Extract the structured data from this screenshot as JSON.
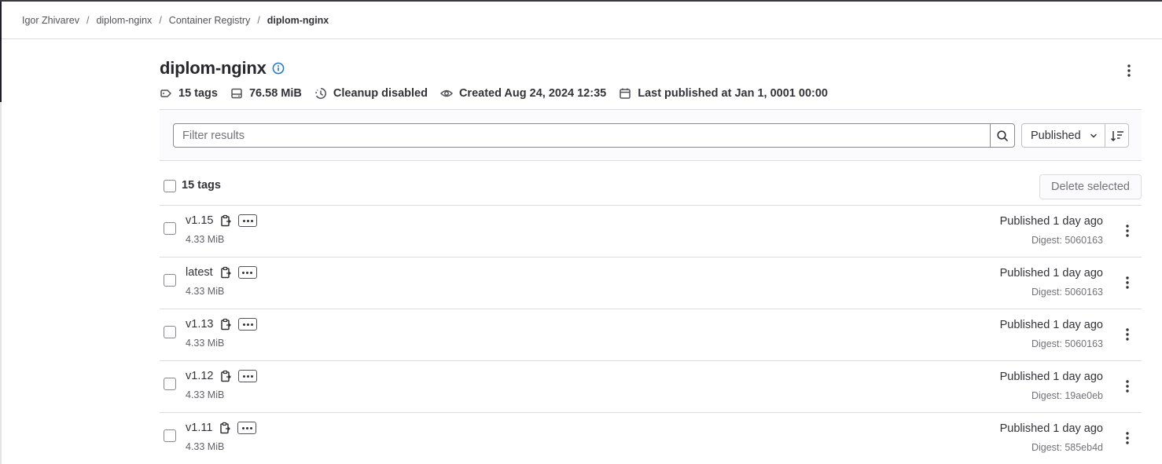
{
  "breadcrumb": {
    "items": [
      "Igor Zhivarev",
      "diplom-nginx",
      "Container Registry"
    ],
    "current": "diplom-nginx",
    "separator": "/"
  },
  "header": {
    "title": "diplom-nginx",
    "meta": {
      "tags": "15 tags",
      "size": "76.58 MiB",
      "cleanup": "Cleanup disabled",
      "created": "Created Aug 24, 2024 12:35",
      "last_published": "Last published at Jan 1, 0001 00:00"
    }
  },
  "filter": {
    "placeholder": "Filter results",
    "sort_label": "Published"
  },
  "list": {
    "count_label": "15 tags",
    "delete_label": "Delete selected",
    "rows": [
      {
        "name": "v1.15",
        "size": "4.33 MiB",
        "published": "Published 1 day ago",
        "digest": "Digest: 5060163"
      },
      {
        "name": "latest",
        "size": "4.33 MiB",
        "published": "Published 1 day ago",
        "digest": "Digest: 5060163"
      },
      {
        "name": "v1.13",
        "size": "4.33 MiB",
        "published": "Published 1 day ago",
        "digest": "Digest: 5060163"
      },
      {
        "name": "v1.12",
        "size": "4.33 MiB",
        "published": "Published 1 day ago",
        "digest": "Digest: 19ae0eb"
      },
      {
        "name": "v1.11",
        "size": "4.33 MiB",
        "published": "Published 1 day ago",
        "digest": "Digest: 585eb4d"
      }
    ]
  },
  "colors": {
    "text": "#333238",
    "muted": "#737278",
    "border": "#dcdcde",
    "info": "#1f75cb"
  }
}
